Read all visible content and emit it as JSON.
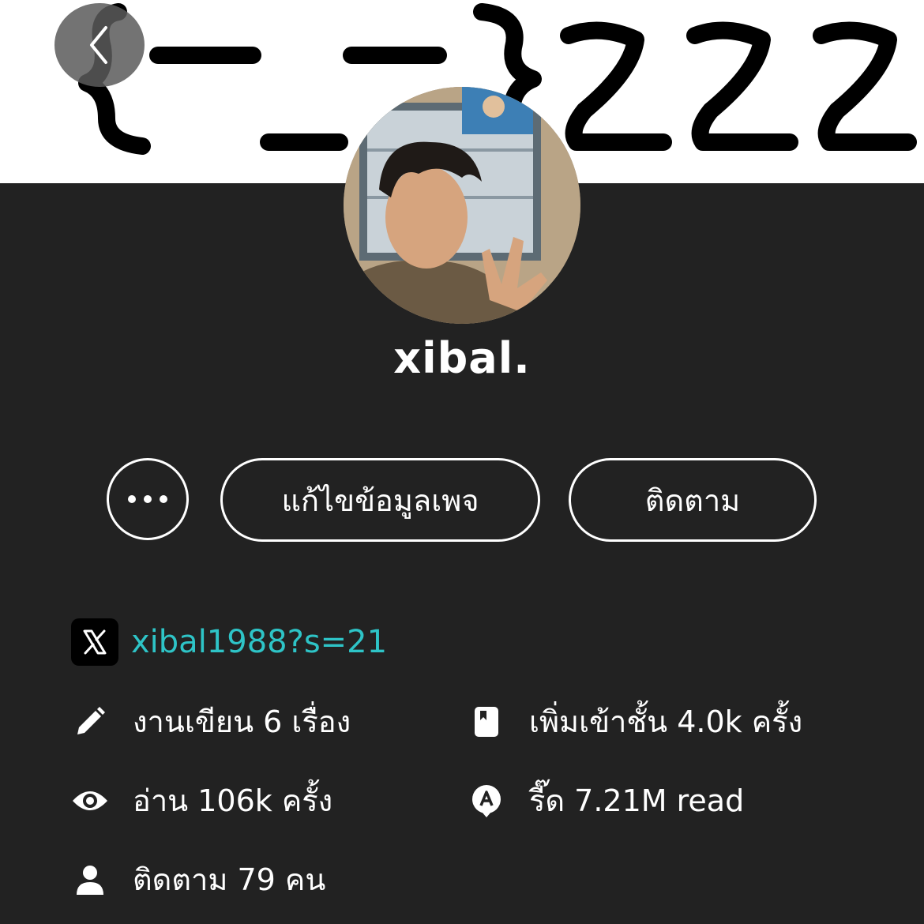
{
  "banner": {
    "image_text": "{-_-}zzzz",
    "icon": "doodle-banner"
  },
  "nav": {
    "back_icon": "chevron-left-icon"
  },
  "profile": {
    "name": "xibal."
  },
  "actions": {
    "more_icon": "ellipsis-icon",
    "edit_label": "แก้ไขข้อมูลเพจ",
    "follow_label": "ติดตาม"
  },
  "social": {
    "x_icon": "x-logo-icon",
    "x_handle": "xibal1988?s=21",
    "link_color": "#2ec4c7"
  },
  "stats": {
    "works": {
      "icon": "pencil-icon",
      "text": "งานเขียน 6 เรื่อง"
    },
    "library": {
      "icon": "bookmark-book-icon",
      "text": "เพิ่มเข้าชั้น 4.0k ครั้ง"
    },
    "reads": {
      "icon": "eye-icon",
      "text": "อ่าน 106k ครั้ง"
    },
    "reed": {
      "icon": "reed-coin-icon",
      "text": "รี๊ด 7.21M read"
    },
    "followers": {
      "icon": "person-icon",
      "text": "ติดตาม 79 คน"
    }
  },
  "colors": {
    "background": "#222222",
    "text": "#ffffff",
    "accent": "#2ec4c7"
  }
}
